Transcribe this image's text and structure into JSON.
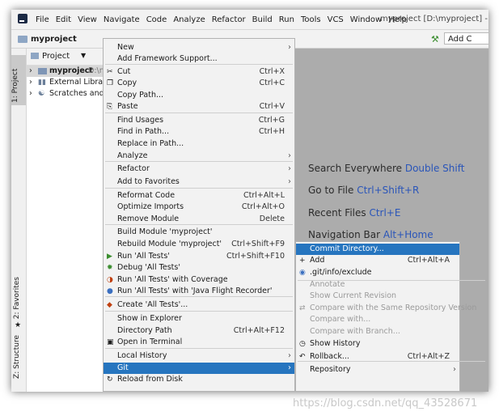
{
  "window": {
    "title": "myproject [D:\\myproject] -",
    "menu": [
      "File",
      "Edit",
      "View",
      "Navigate",
      "Code",
      "Analyze",
      "Refactor",
      "Build",
      "Run",
      "Tools",
      "VCS",
      "Window",
      "Help"
    ]
  },
  "navbar": {
    "breadcrumb": "myproject",
    "add_config": "Add C"
  },
  "side_tabs": {
    "project": "1: Project",
    "favorites": "2: Favorites",
    "structure": "Z: Structure"
  },
  "project_panel": {
    "header": "Project",
    "tree": [
      {
        "label": "myproject",
        "suffix": "D:\\m"
      },
      {
        "label": "External Librarie"
      },
      {
        "label": "Scratches and C"
      }
    ]
  },
  "editor_tips": [
    {
      "text": "Search Everywhere",
      "key": "Double Shift"
    },
    {
      "text": "Go to File",
      "key": "Ctrl+Shift+R"
    },
    {
      "text": "Recent Files",
      "key": "Ctrl+E"
    },
    {
      "text": "Navigation Bar",
      "key": "Alt+Home"
    }
  ],
  "context_menu": [
    {
      "label": "New",
      "shortcut": "",
      "submenu": true,
      "icon": ""
    },
    {
      "label": "Add Framework Support...",
      "shortcut": "",
      "submenu": false,
      "icon": ""
    },
    {
      "label": "Cut",
      "shortcut": "Ctrl+X",
      "submenu": false,
      "icon": "scissors-icon"
    },
    {
      "label": "Copy",
      "shortcut": "Ctrl+C",
      "submenu": false,
      "icon": "copy-icon"
    },
    {
      "label": "Copy Path...",
      "shortcut": "",
      "submenu": false,
      "icon": ""
    },
    {
      "label": "Paste",
      "shortcut": "Ctrl+V",
      "submenu": false,
      "icon": "paste-icon"
    },
    {
      "label": "Find Usages",
      "shortcut": "Ctrl+G",
      "submenu": false,
      "icon": ""
    },
    {
      "label": "Find in Path...",
      "shortcut": "Ctrl+H",
      "submenu": false,
      "icon": ""
    },
    {
      "label": "Replace in Path...",
      "shortcut": "",
      "submenu": false,
      "icon": ""
    },
    {
      "label": "Analyze",
      "shortcut": "",
      "submenu": true,
      "icon": ""
    },
    {
      "label": "Refactor",
      "shortcut": "",
      "submenu": true,
      "icon": ""
    },
    {
      "label": "Add to Favorites",
      "shortcut": "",
      "submenu": true,
      "icon": ""
    },
    {
      "label": "Reformat Code",
      "shortcut": "Ctrl+Alt+L",
      "submenu": false,
      "icon": ""
    },
    {
      "label": "Optimize Imports",
      "shortcut": "Ctrl+Alt+O",
      "submenu": false,
      "icon": ""
    },
    {
      "label": "Remove Module",
      "shortcut": "Delete",
      "submenu": false,
      "icon": ""
    },
    {
      "label": "Build Module 'myproject'",
      "shortcut": "",
      "submenu": false,
      "icon": ""
    },
    {
      "label": "Rebuild Module 'myproject'",
      "shortcut": "Ctrl+Shift+F9",
      "submenu": false,
      "icon": ""
    },
    {
      "label": "Run 'All Tests'",
      "shortcut": "Ctrl+Shift+F10",
      "submenu": false,
      "icon": "run-icon"
    },
    {
      "label": "Debug 'All Tests'",
      "shortcut": "",
      "submenu": false,
      "icon": "debug-icon"
    },
    {
      "label": "Run 'All Tests' with Coverage",
      "shortcut": "",
      "submenu": false,
      "icon": "coverage-icon"
    },
    {
      "label": "Run 'All Tests' with 'Java Flight Recorder'",
      "shortcut": "",
      "submenu": false,
      "icon": "profiler-icon"
    },
    {
      "label": "Create 'All Tests'...",
      "shortcut": "",
      "submenu": false,
      "icon": "create-config-icon"
    },
    {
      "label": "Show in Explorer",
      "shortcut": "",
      "submenu": false,
      "icon": ""
    },
    {
      "label": "Directory Path",
      "shortcut": "Ctrl+Alt+F12",
      "submenu": false,
      "icon": ""
    },
    {
      "label": "Open in Terminal",
      "shortcut": "",
      "submenu": false,
      "icon": "terminal-icon"
    },
    {
      "label": "Local History",
      "shortcut": "",
      "submenu": true,
      "icon": ""
    },
    {
      "label": "Git",
      "shortcut": "",
      "submenu": true,
      "icon": ""
    },
    {
      "label": "Reload from Disk",
      "shortcut": "",
      "submenu": false,
      "icon": "reload-icon"
    }
  ],
  "git_submenu": [
    {
      "label": "Commit Directory...",
      "shortcut": "",
      "submenu": false,
      "disabled": false,
      "icon": ""
    },
    {
      "label": "Add",
      "shortcut": "Ctrl+Alt+A",
      "submenu": false,
      "disabled": false,
      "icon": "plus-icon"
    },
    {
      "label": ".git/info/exclude",
      "shortcut": "",
      "submenu": false,
      "disabled": false,
      "icon": "git-icon"
    },
    {
      "label": "Annotate",
      "shortcut": "",
      "submenu": false,
      "disabled": true,
      "icon": ""
    },
    {
      "label": "Show Current Revision",
      "shortcut": "",
      "submenu": false,
      "disabled": true,
      "icon": ""
    },
    {
      "label": "Compare with the Same Repository Version",
      "shortcut": "",
      "submenu": false,
      "disabled": true,
      "icon": "compare-icon"
    },
    {
      "label": "Compare with...",
      "shortcut": "",
      "submenu": false,
      "disabled": true,
      "icon": ""
    },
    {
      "label": "Compare with Branch...",
      "shortcut": "",
      "submenu": false,
      "disabled": true,
      "icon": ""
    },
    {
      "label": "Show History",
      "shortcut": "",
      "submenu": false,
      "disabled": false,
      "icon": "clock-icon"
    },
    {
      "label": "Rollback...",
      "shortcut": "Ctrl+Alt+Z",
      "submenu": false,
      "disabled": false,
      "icon": "rollback-icon"
    },
    {
      "label": "Repository",
      "shortcut": "",
      "submenu": true,
      "disabled": false,
      "icon": ""
    }
  ],
  "watermark": "https://blog.csdn.net/qq_43528671",
  "colors": {
    "highlight": "#2675bf",
    "shortcut_blue": "#2a55b9",
    "editor_bg": "#acacac"
  }
}
